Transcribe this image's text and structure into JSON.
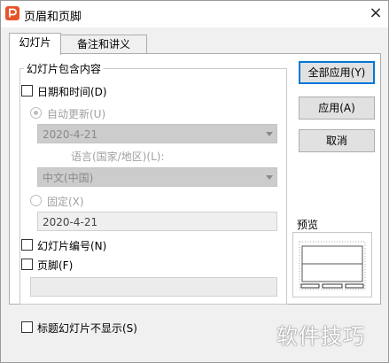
{
  "window": {
    "title": "页眉和页脚",
    "close_glyph": "×"
  },
  "tabs": [
    {
      "label": "幻灯片",
      "selected": true
    },
    {
      "label": "备注和讲义",
      "selected": false
    }
  ],
  "group": {
    "legend": "幻灯片包含内容",
    "date_time": {
      "label": "日期和时间(D)",
      "checked": false
    },
    "auto_update": {
      "label": "自动更新(U)",
      "selected": true,
      "disabled": true,
      "value": "2020-4-21"
    },
    "language": {
      "label": "语言(国家/地区)(L):",
      "value": "中文(中国)"
    },
    "fixed": {
      "label": "固定(X)",
      "selected": false,
      "disabled": true,
      "value": "2020-4-21"
    },
    "slide_number": {
      "label": "幻灯片编号(N)",
      "checked": false
    },
    "footer": {
      "label": "页脚(F)",
      "checked": false,
      "value": ""
    }
  },
  "buttons": {
    "apply_all": "全部应用(Y)",
    "apply": "应用(A)",
    "cancel": "取消"
  },
  "preview": {
    "label": "预览"
  },
  "title_slide_hide": {
    "label": "标题幻灯片不显示(S)",
    "checked": false
  },
  "watermark": "软件技巧",
  "colors": {
    "accent": "#0078d7",
    "app_icon": "#e8542a",
    "disabled_text": "#a0a0a0"
  }
}
